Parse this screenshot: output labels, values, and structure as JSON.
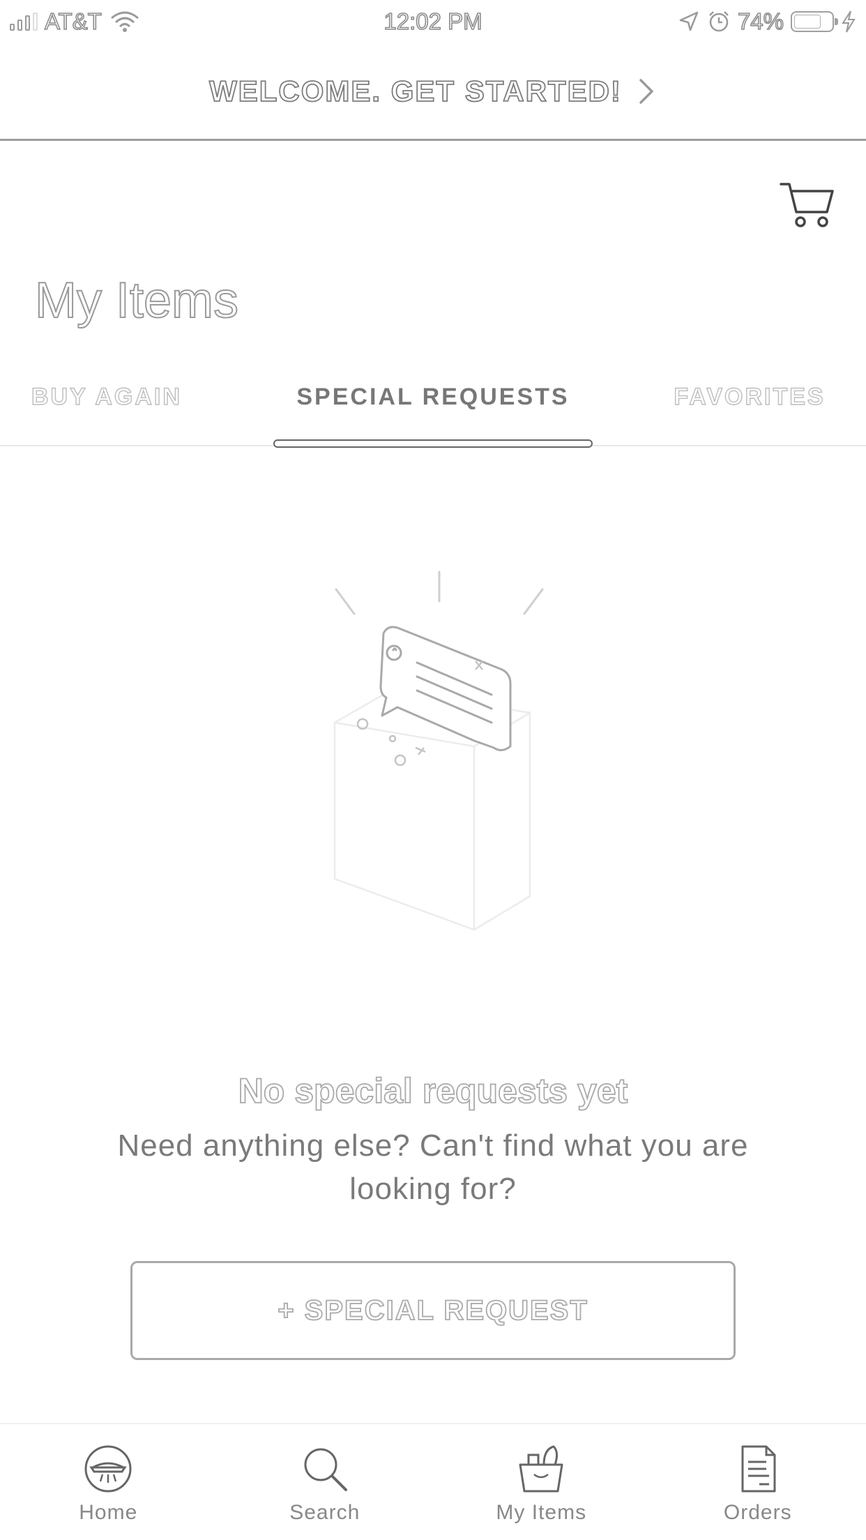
{
  "status_bar": {
    "carrier": "AT&T",
    "time": "12:02 PM",
    "battery": "74%",
    "battery_level": 0.74,
    "icons": [
      "signal-icon",
      "wifi-icon",
      "location-icon",
      "alarm-icon",
      "battery-icon",
      "charging-icon"
    ]
  },
  "banner": {
    "text": "WELCOME. GET STARTED!",
    "chevron_icon": "chevron-right-icon"
  },
  "header": {
    "cart_icon": "cart-icon",
    "title": "My Items"
  },
  "tabs": [
    {
      "label": "BUY AGAIN",
      "active": false
    },
    {
      "label": "SPECIAL REQUESTS",
      "active": true
    },
    {
      "label": "FAVORITES",
      "active": false
    }
  ],
  "empty_state": {
    "illustration_icon": "shopping-bag-message-icon",
    "title": "No special requests yet",
    "subtitle": "Need anything else? Can't find what you are looking for?",
    "button_label": "+ SPECIAL REQUEST"
  },
  "bottom_nav": [
    {
      "label": "Home",
      "icon": "home-icon"
    },
    {
      "label": "Search",
      "icon": "search-icon"
    },
    {
      "label": "My Items",
      "icon": "bag-icon"
    },
    {
      "label": "Orders",
      "icon": "orders-icon"
    }
  ],
  "colors": {
    "text_gray": "#7a7a7a",
    "outline_gray": "#9a9a9a",
    "background": "#ffffff"
  }
}
